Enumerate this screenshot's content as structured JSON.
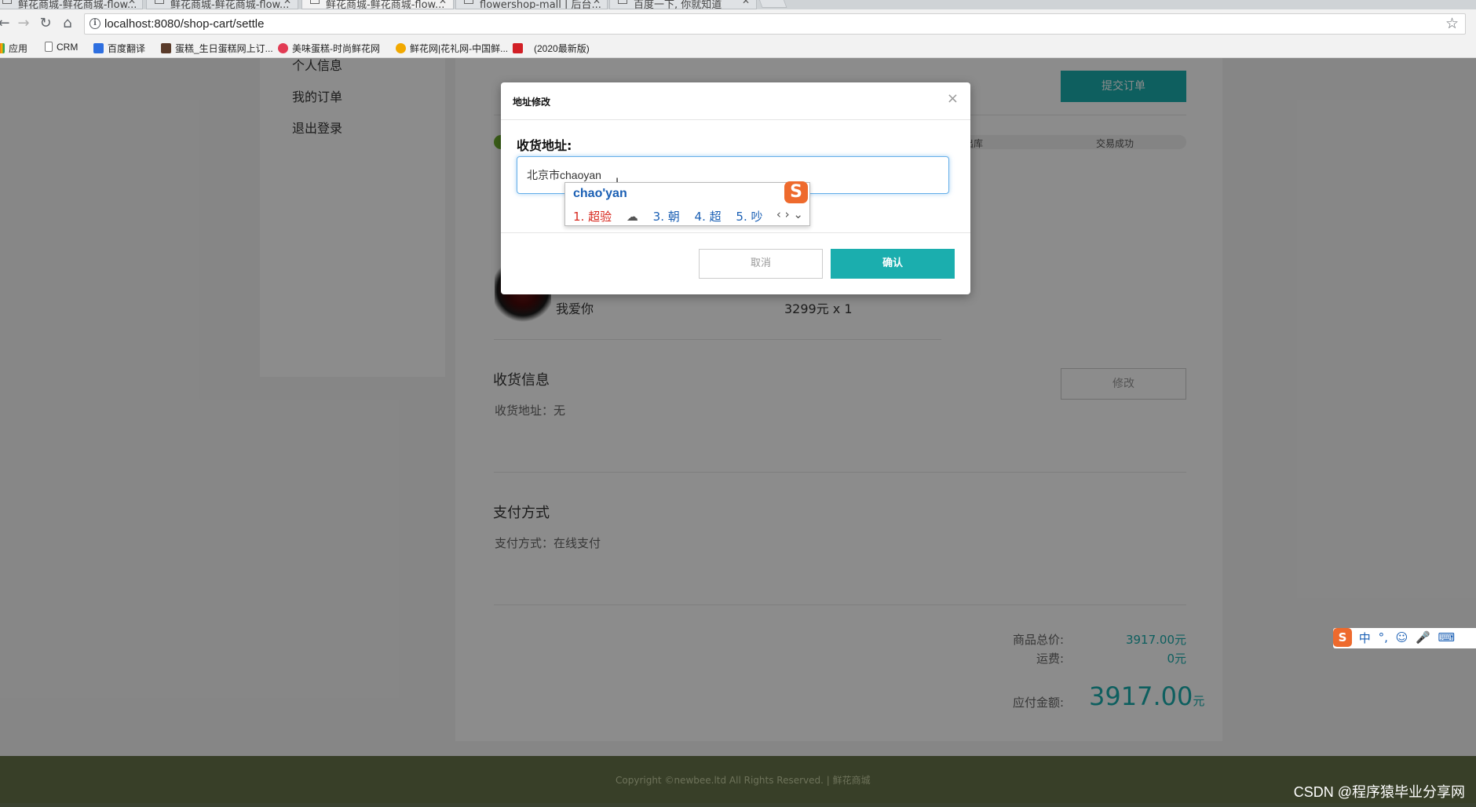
{
  "browser": {
    "tabs": [
      {
        "label": "鲜花商城-鲜花商城-flow..."
      },
      {
        "label": "鲜花商城-鲜花商城-flow..."
      },
      {
        "label": "鲜花商城-鲜花商城-flow..."
      },
      {
        "label": "flowershop-mall | 后台..."
      },
      {
        "label": "百度一下, 你就知道"
      }
    ],
    "url": "localhost:8080/shop-cart/settle",
    "bookmarks": [
      {
        "label": "应用",
        "icon": "apps-grid-icon",
        "color": "#e8453c"
      },
      {
        "label": "CRM",
        "icon": "page-icon",
        "color": "#ffffff"
      },
      {
        "label": "百度翻译",
        "icon": "translate-icon",
        "color": "#2e6fe0"
      },
      {
        "label": "蛋糕_生日蛋糕网上订...",
        "icon": "cake-icon",
        "color": "#5a3b2a"
      },
      {
        "label": "美味蛋糕-时尚鲜花网",
        "icon": "flower-icon",
        "color": "#e23b54"
      },
      {
        "label": "鲜花网|花礼网-中国鲜...",
        "icon": "star-flower-icon",
        "color": "#f2a900"
      },
      {
        "label": "(2020最新版)",
        "icon": "c-logo-icon",
        "color": "#d21f26"
      }
    ]
  },
  "sidebar": {
    "items": [
      {
        "label": "个人信息"
      },
      {
        "label": "我的订单"
      },
      {
        "label": "退出登录"
      }
    ]
  },
  "order": {
    "submit_label": "提交订单",
    "progress": 0.03,
    "steps": [
      {
        "label": "出库"
      },
      {
        "label": "交易成功"
      }
    ],
    "product": {
      "name": "我爱你",
      "price": "3299元 x 1"
    },
    "shipping": {
      "title": "收货信息",
      "address_label": "收货地址：",
      "address_value": "无",
      "edit_label": "修改"
    },
    "payment": {
      "title": "支付方式",
      "label": "支付方式：",
      "value": "在线支付"
    },
    "summary": {
      "subtotal_label": "商品总价:",
      "subtotal_value": "3917.00元",
      "shipping_label": "运费:",
      "shipping_value": "0元",
      "total_label": "应付金额:",
      "total_value": "3917.00",
      "total_unit": "元"
    }
  },
  "footer": {
    "text": "Copyright ©newbee.ltd All Rights Reserved.  |  鲜花商城"
  },
  "modal": {
    "title": "地址修改",
    "field_label": "收货地址:",
    "input_value": "北京市chaoyan",
    "cancel_label": "取消",
    "confirm_label": "确认"
  },
  "ime": {
    "composition": "chao'yan",
    "candidates": [
      "1. 超验",
      "3. 朝",
      "4. 超",
      "5. 吵"
    ],
    "toolbar": [
      "中",
      "°,",
      "☺",
      "🎤",
      "⌨"
    ]
  },
  "watermark": "CSDN @程序猿毕业分享网",
  "colors": {
    "accent": "#1baeae",
    "footer": "#66734a",
    "progress": "#6cae2d"
  }
}
